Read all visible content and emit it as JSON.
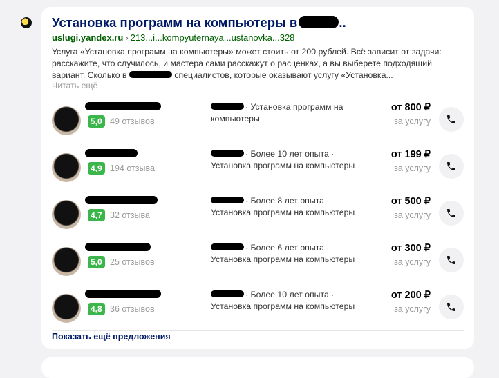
{
  "result": {
    "title": "Установка программ на компьютеры в",
    "title_suffix": "..",
    "domain": "uslugi.yandex.ru",
    "separator": "›",
    "path": "213...i...kompyuternaya...ustanovka...328",
    "snippet_1": "Услуга «Установка программ на компьютеры» может стоить от 200 рублей. Всё зависит от задачи: расскажите, что случилось, и мастера сами расскажут о расценках, а вы выберете подходящий вариант. Сколько в",
    "snippet_2": "специалистов, которые оказывают услугу «Установка...",
    "read_more": "Читать ещё",
    "show_more": "Показать ещё предложения"
  },
  "offers": [
    {
      "rating": "5,0",
      "reviews": "49 отзывов",
      "desc": "· Установка программ на компьютеры",
      "price": "от 800 ₽",
      "unit": "за услугу"
    },
    {
      "rating": "4,9",
      "reviews": "194 отзыва",
      "desc": "· Более 10 лет опыта · Установка программ на компьютеры",
      "price": "от 199 ₽",
      "unit": "за услугу"
    },
    {
      "rating": "4,7",
      "reviews": "32 отзыва",
      "desc": "· Более 8 лет опыта · Установка программ на компьютеры",
      "price": "от 500 ₽",
      "unit": "за услугу"
    },
    {
      "rating": "5,0",
      "reviews": "25 отзывов",
      "desc": "· Более 6 лет опыта · Установка программ на компьютеры",
      "price": "от 300 ₽",
      "unit": "за услугу"
    },
    {
      "rating": "4,8",
      "reviews": "36 отзывов",
      "desc": "· Более 10 лет опыта · Установка программ на компьютеры",
      "price": "от 200 ₽",
      "unit": "за услугу"
    }
  ],
  "icons": {
    "favicon": "yandex-favicon",
    "call": "phone-icon"
  },
  "colors": {
    "rating_badge": "#3bb64a",
    "title": "#001a66",
    "domain": "#006000"
  }
}
